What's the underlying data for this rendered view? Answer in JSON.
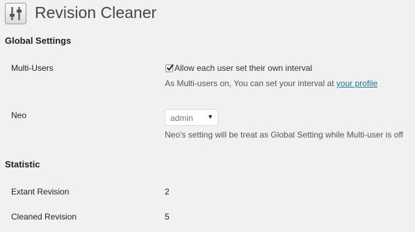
{
  "page": {
    "title": "Revision Cleaner",
    "icon": "settings-sliders-icon"
  },
  "global_settings": {
    "heading": "Global Settings",
    "multi_users": {
      "label": "Multi-Users",
      "checkbox_label": "Allow each user set their own interval",
      "checked": true,
      "desc_prefix": "As Multi-users on, You can set your interval at ",
      "desc_link": "your profile"
    },
    "neo": {
      "label": "Neo",
      "selected": "admin",
      "desc": "Neo's setting will be treat as Global Setting while Multi-user is off"
    }
  },
  "statistic": {
    "heading": "Statistic",
    "extant_label": "Extant Revision",
    "extant_value": "2",
    "cleaned_label": "Cleaned Revision",
    "cleaned_value": "5"
  },
  "colors": {
    "link": "#21759b",
    "background": "#f1f1f1"
  }
}
